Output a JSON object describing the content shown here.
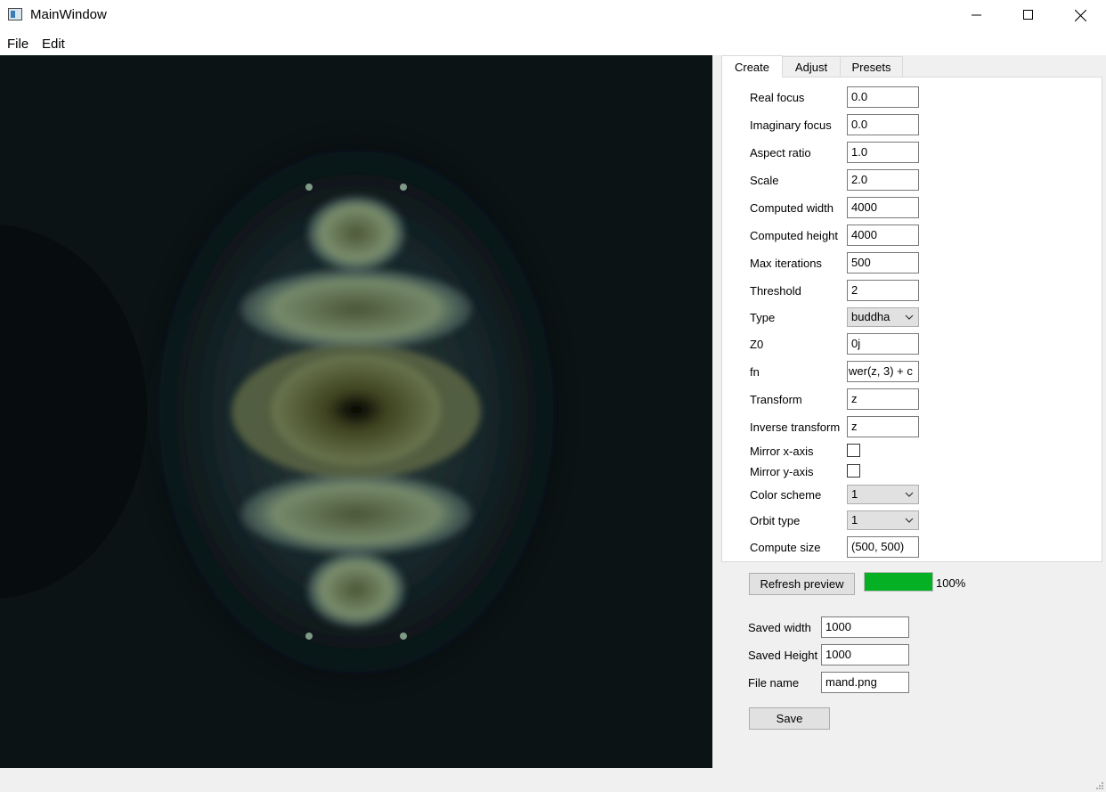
{
  "window": {
    "title": "MainWindow"
  },
  "menu": {
    "items": [
      "File",
      "Edit"
    ]
  },
  "tabs": [
    "Create",
    "Adjust",
    "Presets"
  ],
  "form": {
    "real_focus": {
      "label": "Real focus",
      "value": "0.0"
    },
    "imaginary_focus": {
      "label": "Imaginary focus",
      "value": "0.0"
    },
    "aspect_ratio": {
      "label": "Aspect ratio",
      "value": "1.0"
    },
    "scale": {
      "label": "Scale",
      "value": "2.0"
    },
    "computed_width": {
      "label": "Computed width",
      "value": "4000"
    },
    "computed_height": {
      "label": "Computed height",
      "value": "4000"
    },
    "max_iterations": {
      "label": "Max iterations",
      "value": "500"
    },
    "threshold": {
      "label": "Threshold",
      "value": "2"
    },
    "type": {
      "label": "Type",
      "value": "buddha"
    },
    "z0": {
      "label": "Z0",
      "value": "0j"
    },
    "fn": {
      "label": "fn",
      "value": "wer(z, 3) + c"
    },
    "transform": {
      "label": "Transform",
      "value": "z"
    },
    "inverse_transform": {
      "label": "Inverse transform",
      "value": "z"
    },
    "mirror_x": {
      "label": "Mirror x-axis",
      "checked": false
    },
    "mirror_y": {
      "label": "Mirror y-axis",
      "checked": false
    },
    "color_scheme": {
      "label": "Color scheme",
      "value": "1"
    },
    "orbit_type": {
      "label": "Orbit type",
      "value": "1"
    },
    "compute_size": {
      "label": "Compute size",
      "value": "(500, 500)"
    }
  },
  "preview": {
    "button_label": "Refresh preview",
    "progress_percent": 100,
    "progress_text": "100%",
    "progress_color": "#06b025"
  },
  "save": {
    "saved_width": {
      "label": "Saved width",
      "value": "1000"
    },
    "saved_height": {
      "label": "Saved Height",
      "value": "1000"
    },
    "file_name": {
      "label": "File name",
      "value": "mand.png"
    },
    "button_label": "Save"
  },
  "icons": {
    "minimize": "minimize-icon",
    "maximize": "maximize-icon",
    "close": "close-icon",
    "dropdown": "chevron-down-icon"
  }
}
